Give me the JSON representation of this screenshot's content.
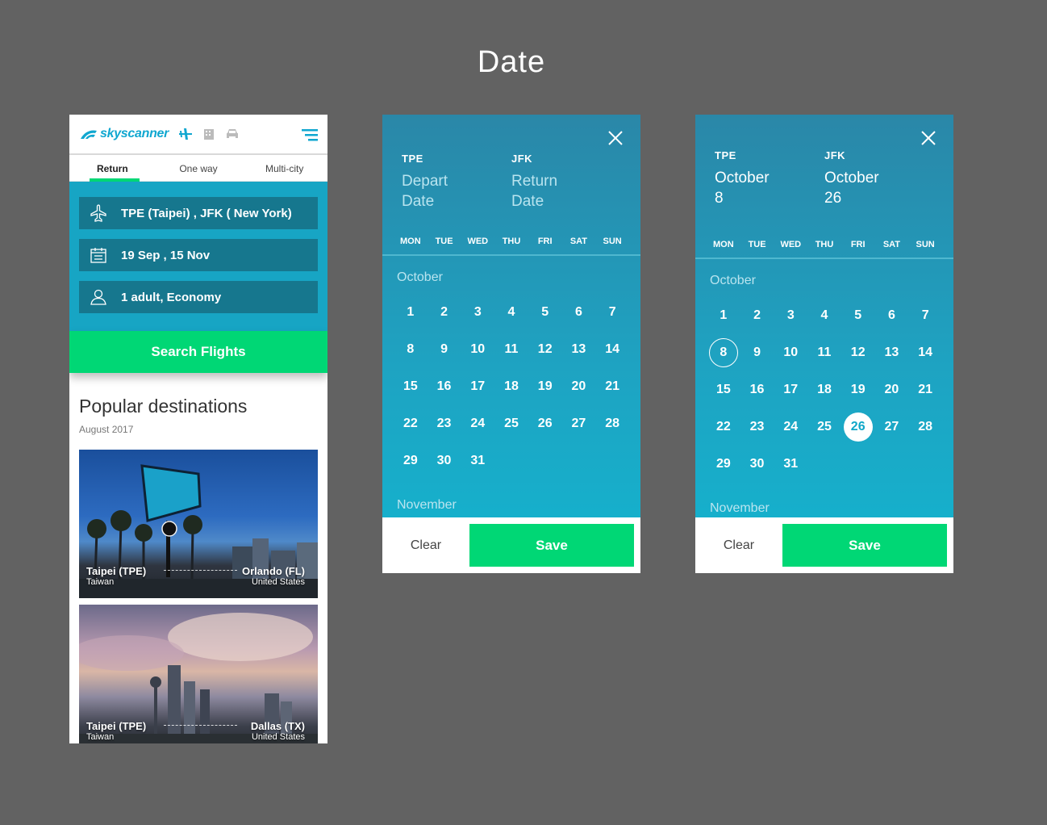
{
  "page": {
    "title": "Date"
  },
  "screen1": {
    "logo_text": "skyscanner",
    "tabs": [
      "Return",
      "One way",
      "Multi-city"
    ],
    "fields": {
      "route": "TPE (Taipei) ,  JFK ( New York)",
      "dates": "19 Sep ,  15 Nov",
      "passengers": "1 adult, Economy"
    },
    "search_label": "Search Flights",
    "popular_title": "Popular destinations",
    "popular_date": "August 2017",
    "cards": [
      {
        "from_city": "Taipei  (TPE)",
        "from_country": "Taiwan",
        "to_city": "Orlando (FL)",
        "to_country": "United States"
      },
      {
        "from_city": "Taipei  (TPE)",
        "from_country": "Taiwan",
        "to_city": "Dallas (TX)",
        "to_country": "United States"
      }
    ]
  },
  "calendar_empty": {
    "from_code": "TPE",
    "from_label_1": "Depart",
    "from_label_2": "Date",
    "to_code": "JFK",
    "to_label_1": "Return",
    "to_label_2": "Date",
    "weekdays": [
      "MON",
      "TUE",
      "WED",
      "THU",
      "FRI",
      "SAT",
      "SUN"
    ],
    "month": "October",
    "next_month": "November",
    "days": [
      "1",
      "2",
      "3",
      "4",
      "5",
      "6",
      "7",
      "8",
      "9",
      "10",
      "11",
      "12",
      "13",
      "14",
      "15",
      "16",
      "17",
      "18",
      "19",
      "20",
      "21",
      "22",
      "23",
      "24",
      "25",
      "26",
      "27",
      "28",
      "29",
      "30",
      "31"
    ],
    "clear_label": "Clear",
    "save_label": "Save"
  },
  "calendar_selected": {
    "from_code": "TPE",
    "from_label_1": "October",
    "from_label_2": "8",
    "to_code": "JFK",
    "to_label_1": "October",
    "to_label_2": "26",
    "weekdays": [
      "MON",
      "TUE",
      "WED",
      "THU",
      "FRI",
      "SAT",
      "SUN"
    ],
    "month": "October",
    "next_month": "November",
    "days": [
      "1",
      "2",
      "3",
      "4",
      "5",
      "6",
      "7",
      "8",
      "9",
      "10",
      "11",
      "12",
      "13",
      "14",
      "15",
      "16",
      "17",
      "18",
      "19",
      "20",
      "21",
      "22",
      "23",
      "24",
      "25",
      "26",
      "27",
      "28",
      "29",
      "30",
      "31"
    ],
    "selected_start": "8",
    "selected_end": "26",
    "clear_label": "Clear",
    "save_label": "Save"
  },
  "colors": {
    "background": "#626262",
    "accent_green": "#00d775",
    "brand_blue": "#17a5c4"
  }
}
